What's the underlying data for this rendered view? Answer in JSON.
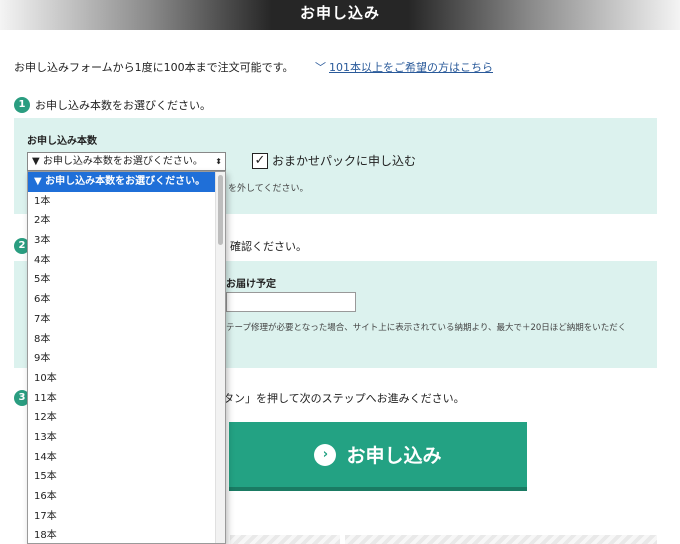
{
  "header": {
    "title": "お申し込み"
  },
  "intro": {
    "text": "お申し込みフォームから1度に100本まで注文可能です。",
    "link_chevron": "﹀",
    "link_text": "101本以上をご希望の方はこちら"
  },
  "steps": [
    {
      "num": "1",
      "text": "お申し込み本数をお選びください。"
    },
    {
      "num": "2",
      "text_tail": "確認ください。"
    },
    {
      "num": "3",
      "text_tail": "ボタン」を押して次のステップへお進みください。"
    }
  ],
  "quantity": {
    "label": "お申し込み本数",
    "selected": "▼ お申し込み本数をお選びください。",
    "arrow": "⬍",
    "options": [
      "▼ お申し込み本数をお選びください。",
      "1本",
      "2本",
      "3本",
      "4本",
      "5本",
      "6本",
      "7本",
      "8本",
      "9本",
      "10本",
      "11本",
      "12本",
      "13本",
      "14本",
      "15本",
      "16本",
      "17本",
      "18本"
    ]
  },
  "pack": {
    "check": "✓",
    "label": "おまかせパックに申し込む"
  },
  "note1": "を外してください。",
  "delivery": {
    "label": "お届け予定",
    "value": "",
    "note": "テープ修理が必要となった場合、サイト上に表示されている納期より、最大で＋20日ほど納期をいただく"
  },
  "submit": {
    "icon": "›",
    "label": "お申し込み"
  },
  "colors": {
    "accent": "#23a283",
    "panel": "#dcf2ee",
    "selection": "#1f6fd8"
  }
}
